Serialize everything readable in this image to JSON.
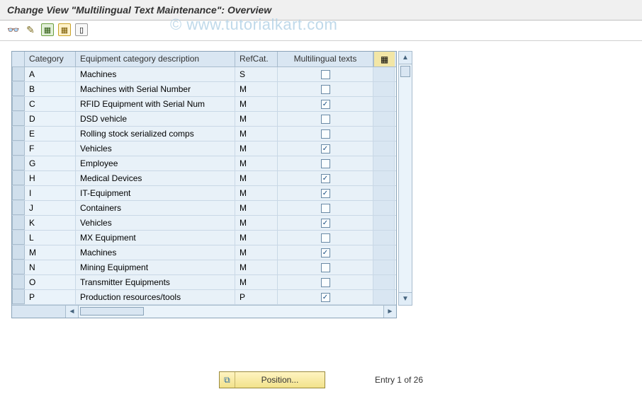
{
  "watermark": "© www.tutorialkart.com",
  "header": {
    "title": "Change View \"Multilingual Text Maintenance\": Overview"
  },
  "toolbar": {
    "details_icon": "details",
    "edit_icon": "edit",
    "select_all_icon": "select-all",
    "select_block_icon": "select-block",
    "deselect_all_icon": "deselect-all"
  },
  "grid": {
    "columns": {
      "category": "Category",
      "description": "Equipment category description",
      "refcat": "RefCat.",
      "multilingual": "Multilingual texts"
    },
    "config_button": "table-settings",
    "rows": [
      {
        "cat": "A",
        "desc": "Machines",
        "ref": "S",
        "ml": false
      },
      {
        "cat": "B",
        "desc": "Machines with Serial Number",
        "ref": "M",
        "ml": false
      },
      {
        "cat": "C",
        "desc": "RFID Equipment with Serial Num",
        "ref": "M",
        "ml": true
      },
      {
        "cat": "D",
        "desc": "DSD vehicle",
        "ref": "M",
        "ml": false
      },
      {
        "cat": "E",
        "desc": "Rolling stock serialized comps",
        "ref": "M",
        "ml": false
      },
      {
        "cat": "F",
        "desc": "Vehicles",
        "ref": "M",
        "ml": true
      },
      {
        "cat": "G",
        "desc": "Employee",
        "ref": "M",
        "ml": false
      },
      {
        "cat": "H",
        "desc": "Medical Devices",
        "ref": "M",
        "ml": true
      },
      {
        "cat": "I",
        "desc": "IT-Equipment",
        "ref": "M",
        "ml": true
      },
      {
        "cat": "J",
        "desc": "Containers",
        "ref": "M",
        "ml": false
      },
      {
        "cat": "K",
        "desc": "Vehicles",
        "ref": "M",
        "ml": true
      },
      {
        "cat": "L",
        "desc": "MX Equipment",
        "ref": "M",
        "ml": false
      },
      {
        "cat": "M",
        "desc": "Machines",
        "ref": "M",
        "ml": true
      },
      {
        "cat": "N",
        "desc": "Mining Equipment",
        "ref": "M",
        "ml": false
      },
      {
        "cat": "O",
        "desc": "Transmitter Equipments",
        "ref": "M",
        "ml": false
      },
      {
        "cat": "P",
        "desc": "Production resources/tools",
        "ref": "P",
        "ml": true
      }
    ]
  },
  "footer": {
    "position_label": "Position...",
    "entry_text": "Entry 1 of 26"
  }
}
